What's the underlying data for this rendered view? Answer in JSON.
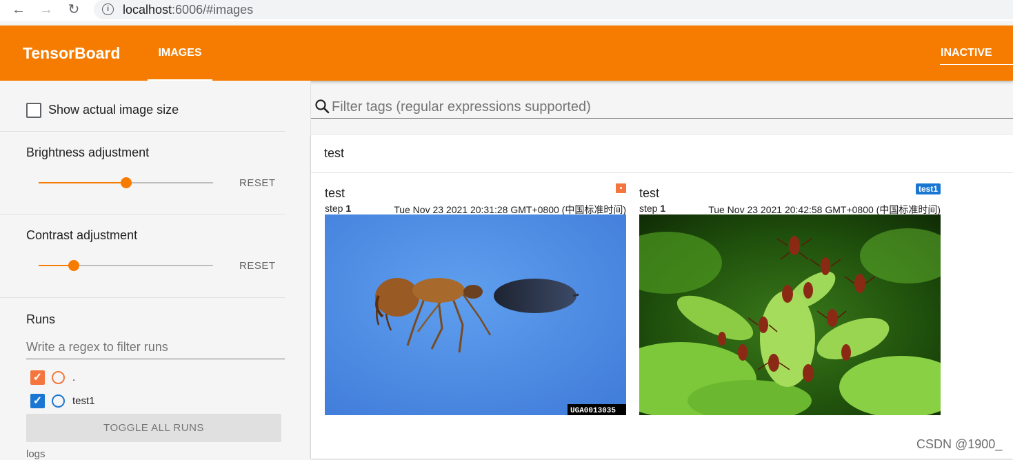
{
  "browser": {
    "url_host": "localhost",
    "url_rest": ":6006/#images"
  },
  "header": {
    "brand": "TensorBoard",
    "active_tab": "IMAGES",
    "status_button": "INACTIVE",
    "accent_color": "#f57c00"
  },
  "sidebar": {
    "show_actual_size_label": "Show actual image size",
    "show_actual_size_checked": false,
    "brightness": {
      "label": "Brightness adjustment",
      "value_fraction": 0.5,
      "reset": "RESET"
    },
    "contrast": {
      "label": "Contrast adjustment",
      "value_fraction": 0.2,
      "reset": "RESET"
    },
    "runs": {
      "title": "Runs",
      "filter_placeholder": "Write a regex to filter runs",
      "items": [
        {
          "name": ".",
          "checked": true,
          "color": "#f4753e"
        },
        {
          "name": "test1",
          "checked": true,
          "color": "#1976d2"
        }
      ],
      "toggle_all": "TOGGLE ALL RUNS",
      "logdir_label": "logs"
    }
  },
  "main": {
    "filter_placeholder": "Filter tags (regular expressions supported)",
    "card_title": "test",
    "images": [
      {
        "tag": "test",
        "step_label": "step",
        "step": "1",
        "timestamp": "Tue Nov 23 2021 20:31:28 GMT+0800 (中国标准时间)",
        "run_color": "#f4753e",
        "run_badge": "",
        "image_caption": "UGA0013035"
      },
      {
        "tag": "test",
        "step_label": "step",
        "step": "1",
        "timestamp": "Tue Nov 23 2021 20:42:58 GMT+0800 (中国标准时间)",
        "run_color": "#1976d2",
        "run_badge": "test1",
        "image_caption": ""
      }
    ]
  },
  "watermark": "CSDN @1900_"
}
